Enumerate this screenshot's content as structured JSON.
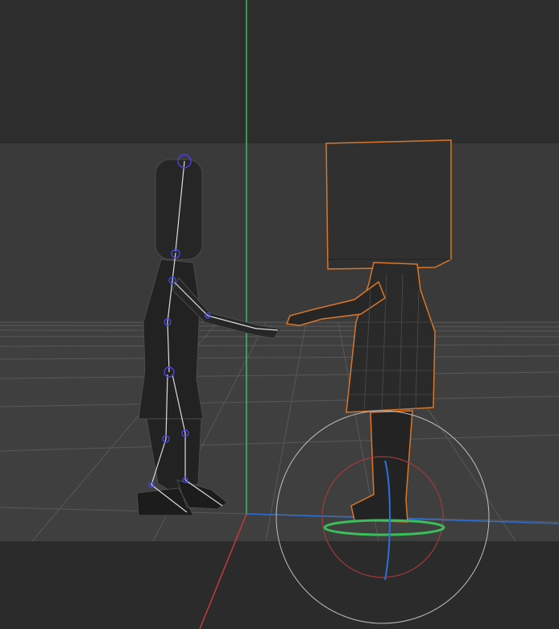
{
  "viewport": {
    "background_top": "#2d2d2d",
    "background_mid": "#3a3a3a",
    "grid_color": "#5a5a5a",
    "axis_x_color": "#c4393a",
    "axis_y_color": "#3bbf5a",
    "axis_z_color": "#2d6fd6",
    "selection_color": "#d8772a",
    "wireframe_color": "#8a8a8a",
    "bone_color": "#dcdcdc",
    "joint_color": "#3f3fd8"
  },
  "objects": [
    {
      "name": "rigged-character",
      "selected": false,
      "shows_bones": true
    },
    {
      "name": "box-head-character",
      "selected": true,
      "shows_bones": false
    }
  ],
  "gizmo": {
    "type": "rotate",
    "rings": [
      "view",
      "x",
      "y",
      "z"
    ]
  }
}
